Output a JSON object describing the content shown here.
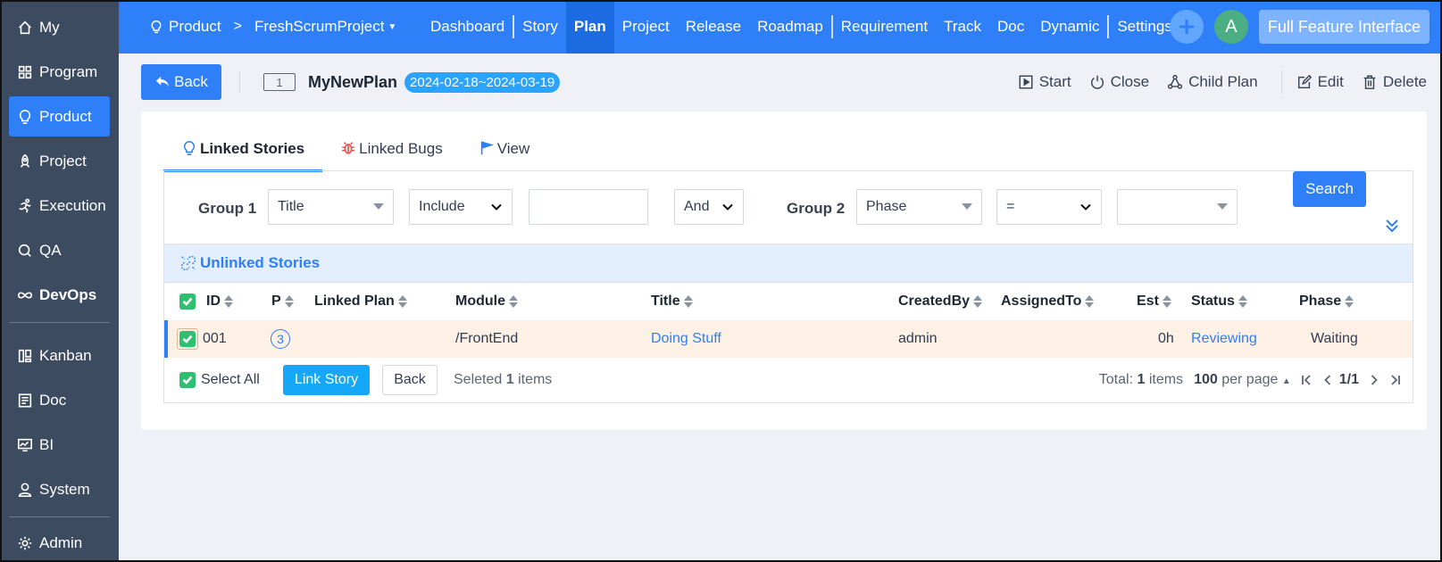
{
  "sidebar": {
    "items": [
      {
        "label": "My",
        "icon": "home-icon"
      },
      {
        "label": "Program",
        "icon": "grid-icon"
      },
      {
        "label": "Product",
        "icon": "lightbulb-icon",
        "active": true
      },
      {
        "label": "Project",
        "icon": "rocket-icon"
      },
      {
        "label": "Execution",
        "icon": "runner-icon"
      },
      {
        "label": "QA",
        "icon": "magnifier-icon"
      },
      {
        "label": "DevOps",
        "icon": "infinity-icon"
      }
    ],
    "items2": [
      {
        "label": "Kanban",
        "icon": "kanban-icon"
      },
      {
        "label": "Doc",
        "icon": "doc-icon"
      },
      {
        "label": "BI",
        "icon": "monitor-icon"
      },
      {
        "label": "System",
        "icon": "user-icon"
      },
      {
        "label": "Admin",
        "icon": "gear-icon"
      }
    ]
  },
  "topbar": {
    "crumb_root": "Product",
    "crumb_sep": ">",
    "crumb_project": "FreshScrumProject",
    "nav": [
      "Dashboard",
      "Story",
      "Plan",
      "Project",
      "Release",
      "Roadmap",
      "Requirement",
      "Track",
      "Doc",
      "Dynamic",
      "Settings"
    ],
    "active_nav": "Plan",
    "avatar_letter": "A",
    "feature_button": "Full Feature Interface"
  },
  "header": {
    "back_label": "Back",
    "plan_id": "1",
    "plan_name": "MyNewPlan",
    "plan_dates": "2024-02-18~2024-03-19",
    "actions": [
      "Start",
      "Close",
      "Child Plan",
      "Edit",
      "Delete"
    ]
  },
  "tabs": [
    "Linked Stories",
    "Linked Bugs",
    "View"
  ],
  "search": {
    "group1_label": "Group 1",
    "group1_field": "Title",
    "group1_operator": "Include",
    "group1_value": "",
    "logic": "And",
    "group2_label": "Group 2",
    "group2_field": "Phase",
    "group2_operator": "=",
    "group2_value": "",
    "search_label": "Search"
  },
  "section_title": "Unlinked Stories",
  "table": {
    "columns": [
      "ID",
      "P",
      "Linked Plan",
      "Module",
      "Title",
      "CreatedBy",
      "AssignedTo",
      "Est",
      "Status",
      "Phase"
    ],
    "rows": [
      {
        "id": "001",
        "pri": "3",
        "linked_plan": "",
        "module": "/FrontEnd",
        "title": "Doing Stuff",
        "created_by": "admin",
        "assigned_to": "",
        "est": "0h",
        "status": "Reviewing",
        "phase": "Waiting"
      }
    ]
  },
  "footer": {
    "select_all": "Select All",
    "link_story": "Link Story",
    "back": "Back",
    "selected_prefix": "Seleted",
    "selected_count": "1",
    "selected_suffix": "items",
    "total_prefix": "Total:",
    "total_count": "1",
    "total_suffix": "items",
    "per_page_count": "100",
    "per_page_suffix": "per page",
    "page": "1/1"
  },
  "colors": {
    "primary": "#2e7ff8",
    "sidebar": "#3c4b5f",
    "success": "#2fbf71"
  }
}
